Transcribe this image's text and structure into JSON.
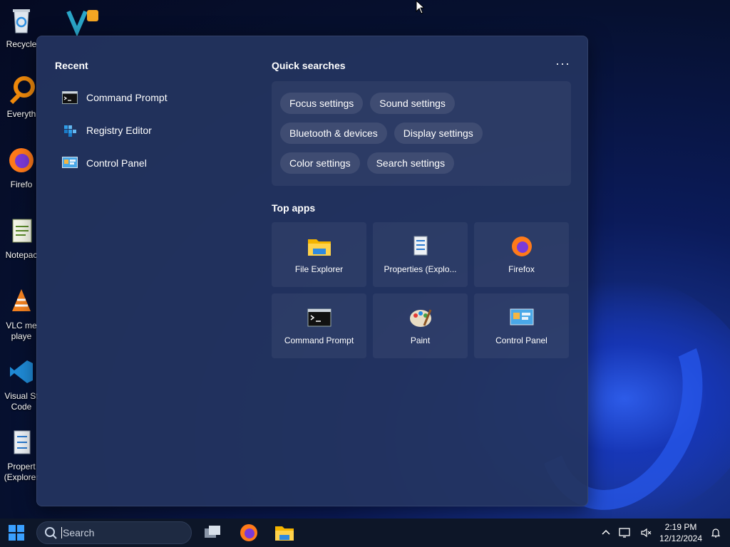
{
  "desktop": {
    "icons": [
      {
        "label": "Recycle",
        "icon": "recycle-bin-icon"
      },
      {
        "label": "Everyth",
        "icon": "everything-search-icon"
      },
      {
        "label": "Firefo",
        "icon": "firefox-icon"
      },
      {
        "label": "Notepac",
        "icon": "notepad-icon"
      },
      {
        "label": "VLC me",
        "label2": "playe",
        "icon": "vlc-icon"
      },
      {
        "label": "Visual St",
        "label2": "Code",
        "icon": "vscode-icon"
      },
      {
        "label": "Propert",
        "label2": "(Explorer",
        "icon": "properties-icon"
      }
    ]
  },
  "flyout": {
    "recent": {
      "title": "Recent",
      "items": [
        {
          "label": "Command Prompt",
          "icon": "command-prompt-icon"
        },
        {
          "label": "Registry Editor",
          "icon": "registry-editor-icon"
        },
        {
          "label": "Control Panel",
          "icon": "control-panel-icon"
        }
      ]
    },
    "quick_searches": {
      "title": "Quick searches",
      "more": "···",
      "chips": [
        [
          "Focus settings",
          "Sound settings"
        ],
        [
          "Bluetooth & devices",
          "Display settings"
        ],
        [
          "Color settings",
          "Search settings"
        ]
      ]
    },
    "top_apps": {
      "title": "Top apps",
      "apps": [
        {
          "label": "File Explorer",
          "icon": "file-explorer-icon"
        },
        {
          "label": "Properties (Explo...",
          "icon": "properties-icon"
        },
        {
          "label": "Firefox",
          "icon": "firefox-icon"
        },
        {
          "label": "Command Prompt",
          "icon": "command-prompt-icon"
        },
        {
          "label": "Paint",
          "icon": "paint-icon"
        },
        {
          "label": "Control Panel",
          "icon": "control-panel-icon"
        }
      ]
    }
  },
  "taskbar": {
    "search_placeholder": "Search",
    "clock_time": "2:19 PM",
    "clock_date": "12/12/2024"
  }
}
